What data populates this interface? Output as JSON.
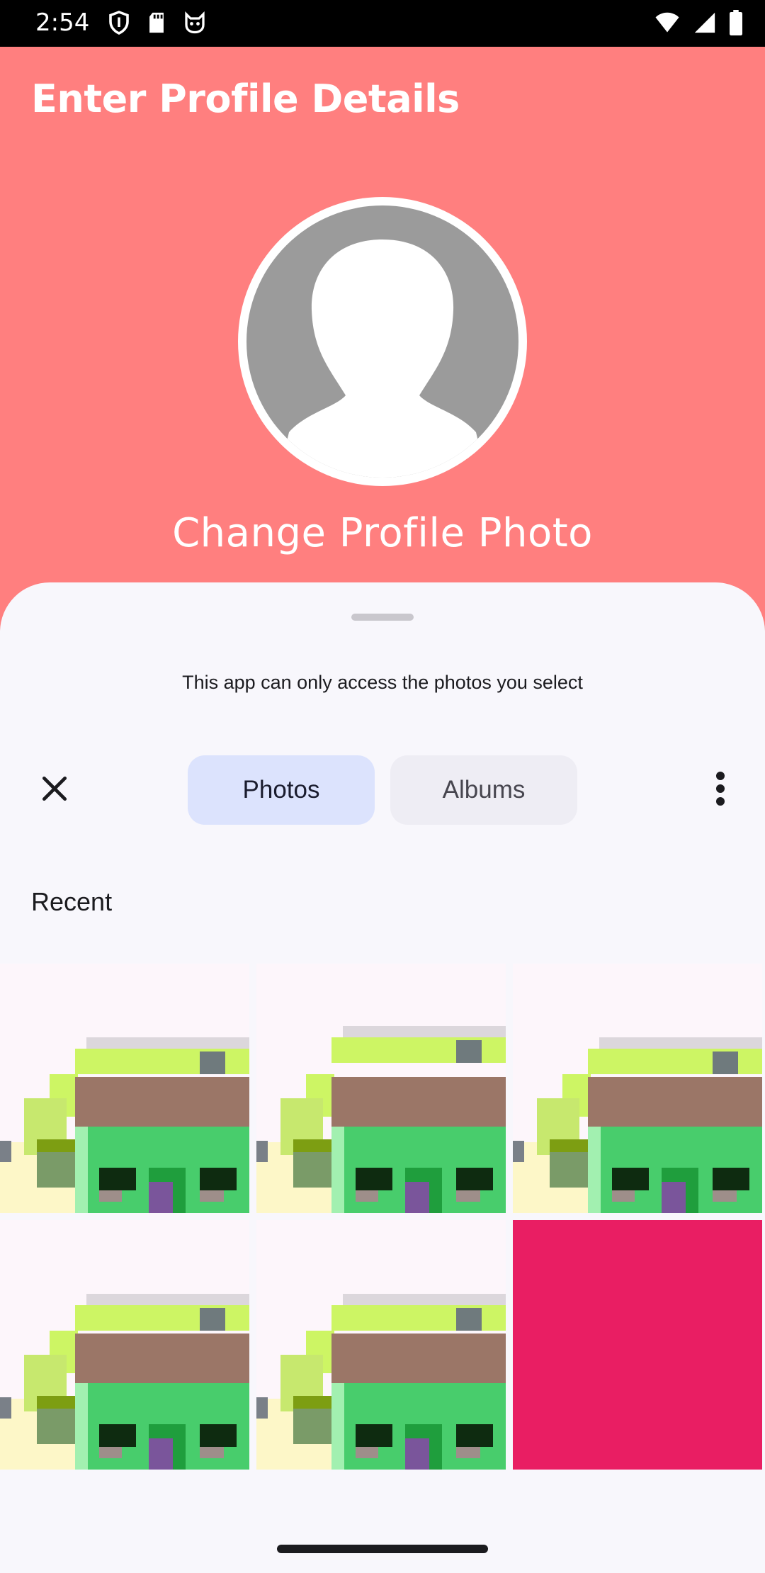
{
  "status_bar": {
    "time": "2:54",
    "left_icons": [
      "shield-icon",
      "sd-card-icon",
      "cat-face-icon"
    ],
    "right_icons": [
      "wifi-icon",
      "signal-icon",
      "battery-icon"
    ]
  },
  "header": {
    "title": "Enter Profile Details",
    "avatar_icon": "person-silhouette-icon",
    "change_photo_label": "Change Profile Photo",
    "background_color": "#ff7f7f"
  },
  "picker": {
    "access_note": "This app can only access the photos you select",
    "close_icon": "close-icon",
    "tabs": [
      {
        "label": "Photos",
        "selected": true
      },
      {
        "label": "Albums",
        "selected": false
      }
    ],
    "more_icon": "more-vert-icon",
    "section_title": "Recent",
    "photos": [
      {
        "kind": "pixel-house",
        "variant": "a"
      },
      {
        "kind": "pixel-house",
        "variant": "b"
      },
      {
        "kind": "pixel-house",
        "variant": "c"
      },
      {
        "kind": "pixel-house",
        "variant": "a"
      },
      {
        "kind": "pixel-house",
        "variant": "d"
      },
      {
        "kind": "solid",
        "color": "#e91e63"
      }
    ]
  }
}
